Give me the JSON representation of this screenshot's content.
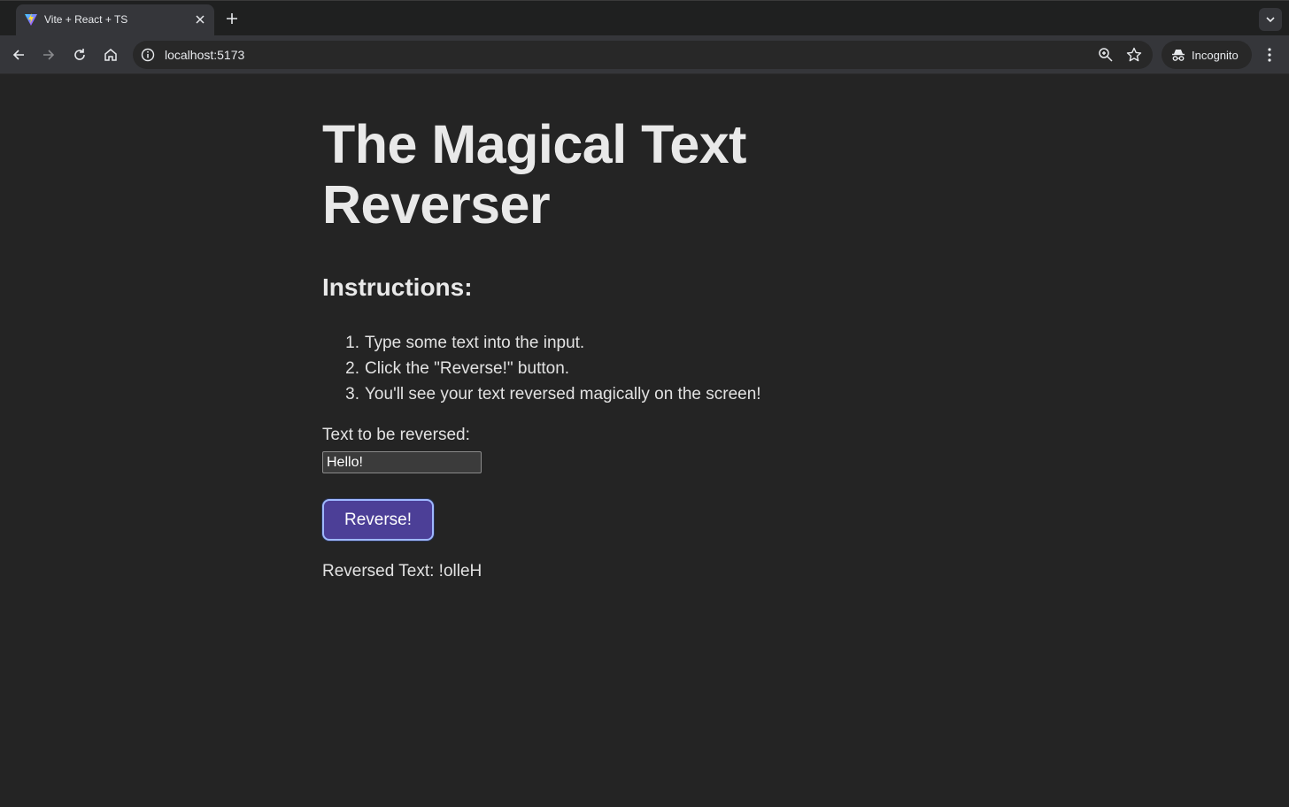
{
  "browser": {
    "tab": {
      "title": "Vite + React + TS"
    },
    "address": {
      "url": "localhost:5173"
    },
    "incognito_label": "Incognito"
  },
  "app": {
    "title": "The Magical Text Reverser",
    "instructions_heading": "Instructions:",
    "steps": [
      {
        "num": "1.",
        "text": "Type some text into the input."
      },
      {
        "num": "2.",
        "text": "Click the \"Reverse!\" button."
      },
      {
        "num": "3.",
        "text": "You'll see your text reversed magically on the screen!"
      }
    ],
    "input_label": "Text to be reversed:",
    "input_value": "Hello!",
    "button_label": "Reverse!",
    "result_prefix": "Reversed Text:",
    "result_value": "!olleH"
  },
  "colors": {
    "background": "#242424",
    "button": "#4c3f97",
    "button_border": "#9fb8ff"
  },
  "icons": [
    "vite-favicon",
    "close-icon",
    "plus-icon",
    "chevron-down-icon",
    "back-icon",
    "forward-icon",
    "reload-icon",
    "home-icon",
    "info-icon",
    "zoom-icon",
    "star-icon",
    "incognito-icon",
    "more-vert-icon"
  ]
}
